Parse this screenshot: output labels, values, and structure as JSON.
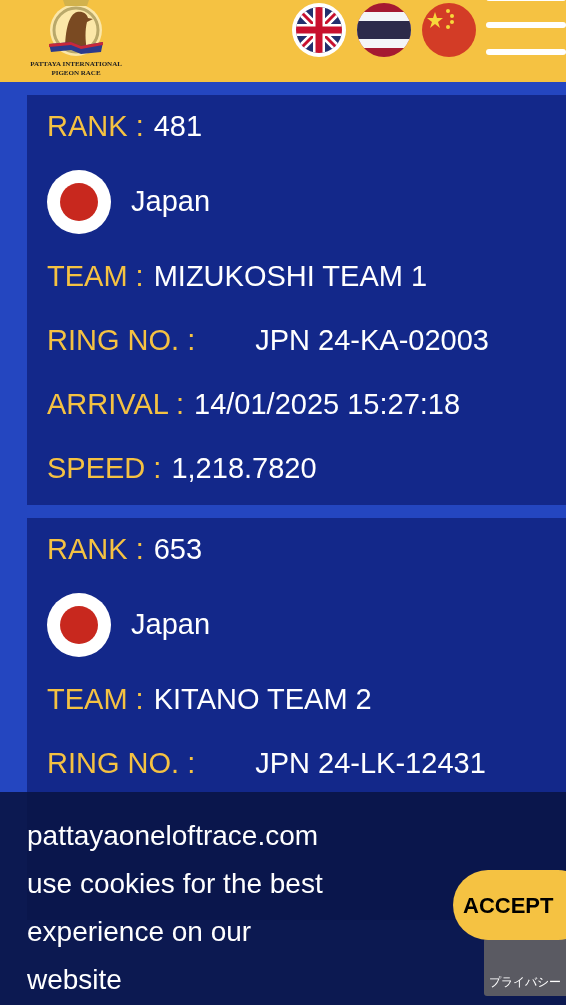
{
  "header": {
    "logo_lines": [
      "PATTAYA INTERNATIONAL",
      "PIGEON RACE"
    ],
    "languages": [
      {
        "kind": "uk"
      },
      {
        "kind": "thai"
      },
      {
        "kind": "china"
      }
    ]
  },
  "results": [
    {
      "rank_label": "RANK :",
      "rank": "481",
      "country": "Japan",
      "team_label": "TEAM :",
      "team": "MIZUKOSHI TEAM 1",
      "ring_label": "RING NO. :",
      "ring": "JPN 24-KA-02003",
      "arrival_label": "ARRIVAL :",
      "arrival": "14/01/2025 15:27:18",
      "speed_label": "SPEED :",
      "speed": "1,218.7820"
    },
    {
      "rank_label": "RANK :",
      "rank": "653",
      "country": "Japan",
      "team_label": "TEAM :",
      "team": "KITANO TEAM 2",
      "ring_label": "RING NO. :",
      "ring": "JPN 24-LK-12431"
    }
  ],
  "cookie_banner": {
    "message": "pattayaoneloftrace.com use cookies for the best experience on our website",
    "accept": "ACCEPT"
  },
  "recaptcha": {
    "text": "プライバシー"
  }
}
